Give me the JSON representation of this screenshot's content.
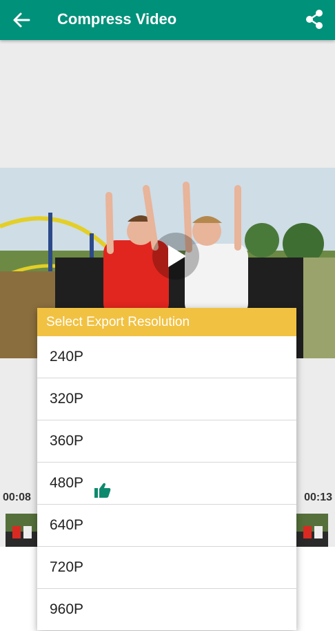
{
  "appbar": {
    "title": "Compress Video",
    "back_icon": "arrow-back-icon",
    "share_icon": "share-icon",
    "color": "#00917a"
  },
  "player": {
    "play_icon": "play-icon",
    "start_time": "00:08",
    "end_time": "00:13"
  },
  "dialog": {
    "title": "Select Export Resolution",
    "header_color": "#f1c141",
    "options": [
      {
        "label": "240P"
      },
      {
        "label": "320P"
      },
      {
        "label": "360P"
      },
      {
        "label": "480P",
        "recommended_icon": "thumbs-up-icon"
      },
      {
        "label": "640P"
      },
      {
        "label": "720P"
      },
      {
        "label": "960P"
      }
    ]
  }
}
